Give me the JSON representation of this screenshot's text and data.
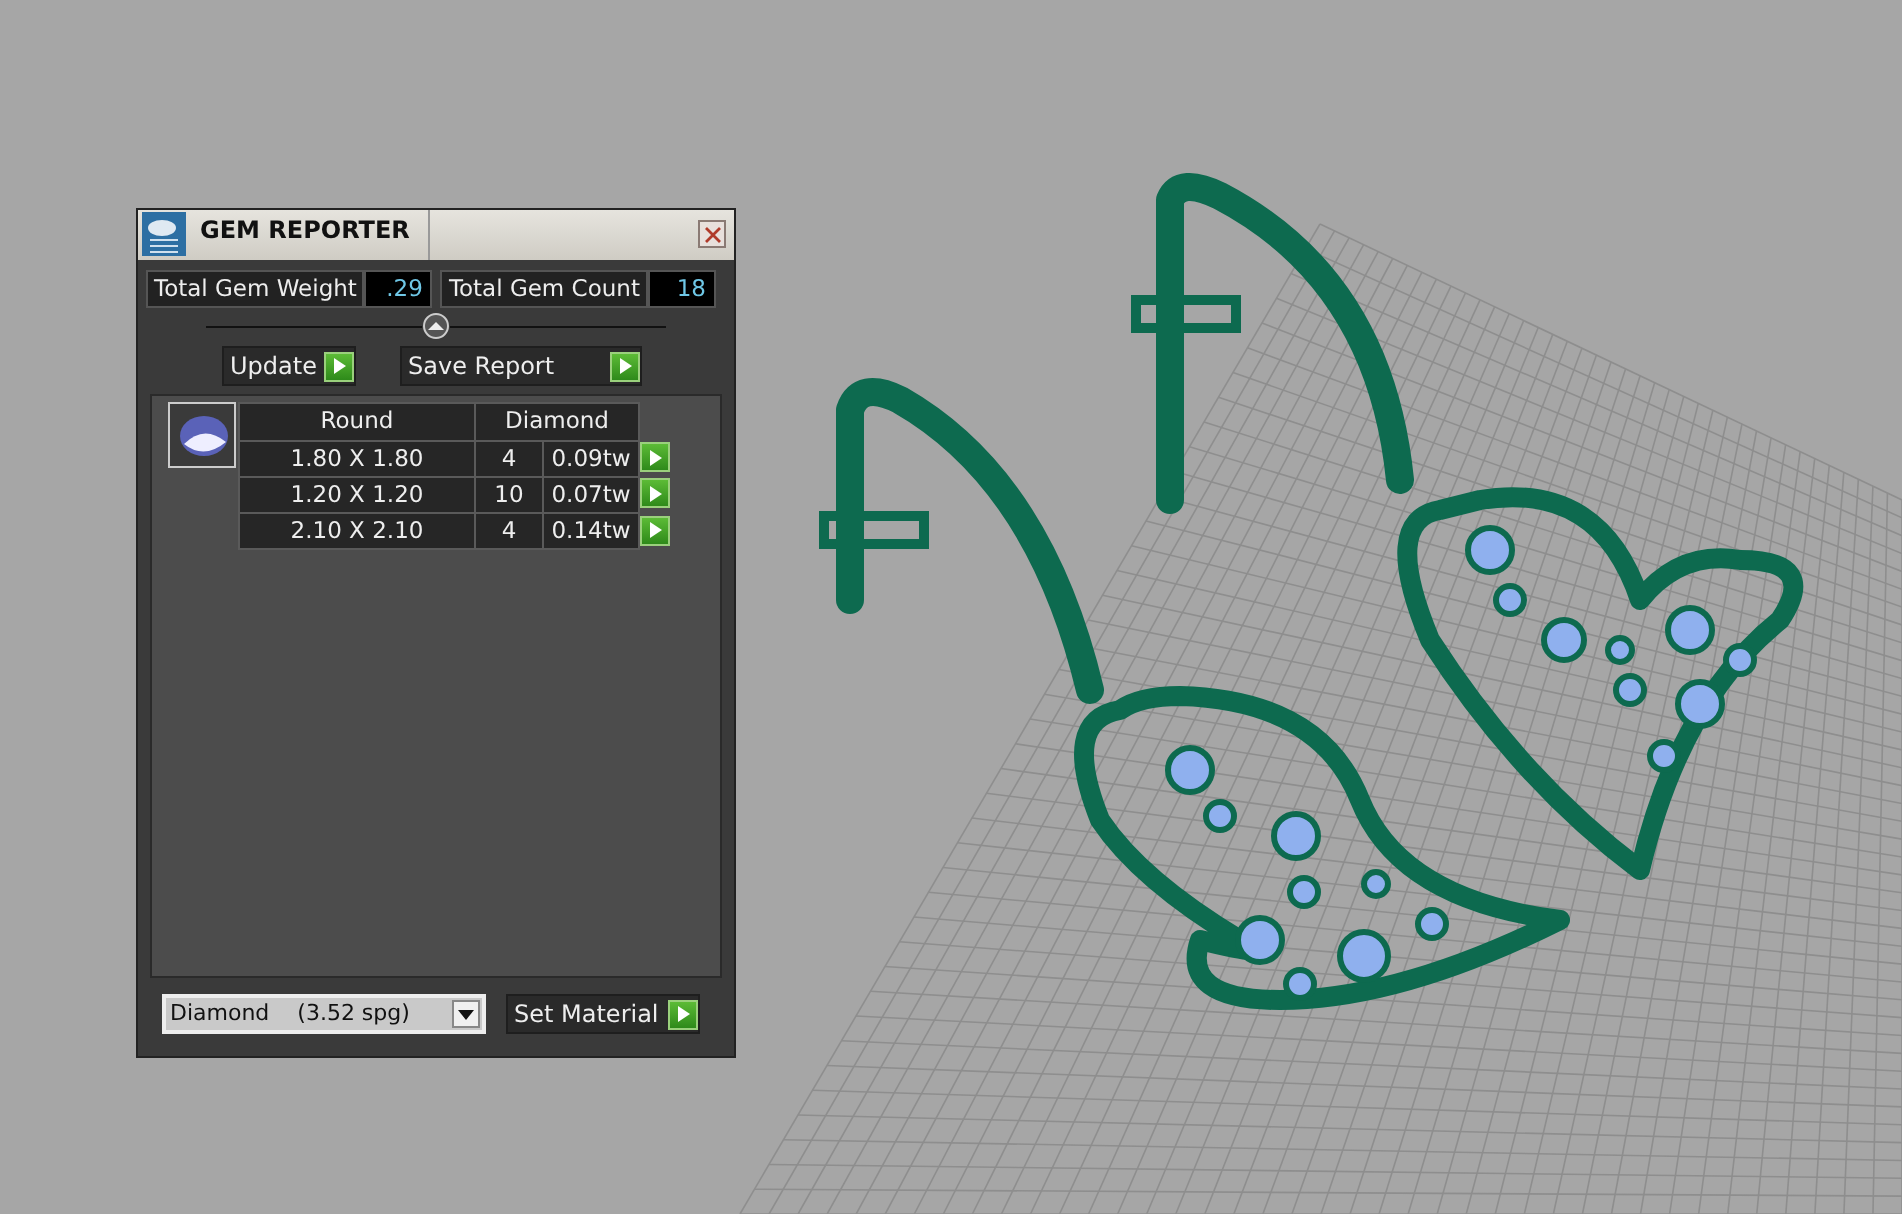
{
  "window": {
    "title": "GEM REPORTER"
  },
  "totals": [
    {
      "label": "Total Gem Weight",
      "value": ".29"
    },
    {
      "label": "Total Gem Count",
      "value": "18"
    }
  ],
  "buttons": [
    {
      "label": "Update"
    },
    {
      "label": "Save Report"
    }
  ],
  "gem_table": {
    "shape": "Round",
    "material": "Diamond",
    "rows": [
      {
        "size": "1.80 X 1.80",
        "count": "4",
        "weight": "0.09tw"
      },
      {
        "size": "1.20 X 1.20",
        "count": "10",
        "weight": "0.07tw"
      },
      {
        "size": "2.10 X 2.10",
        "count": "4",
        "weight": "0.14tw"
      }
    ]
  },
  "material_select": {
    "value": "Diamond    (3.52 spg)"
  },
  "set_button": {
    "label": "Set Material"
  }
}
